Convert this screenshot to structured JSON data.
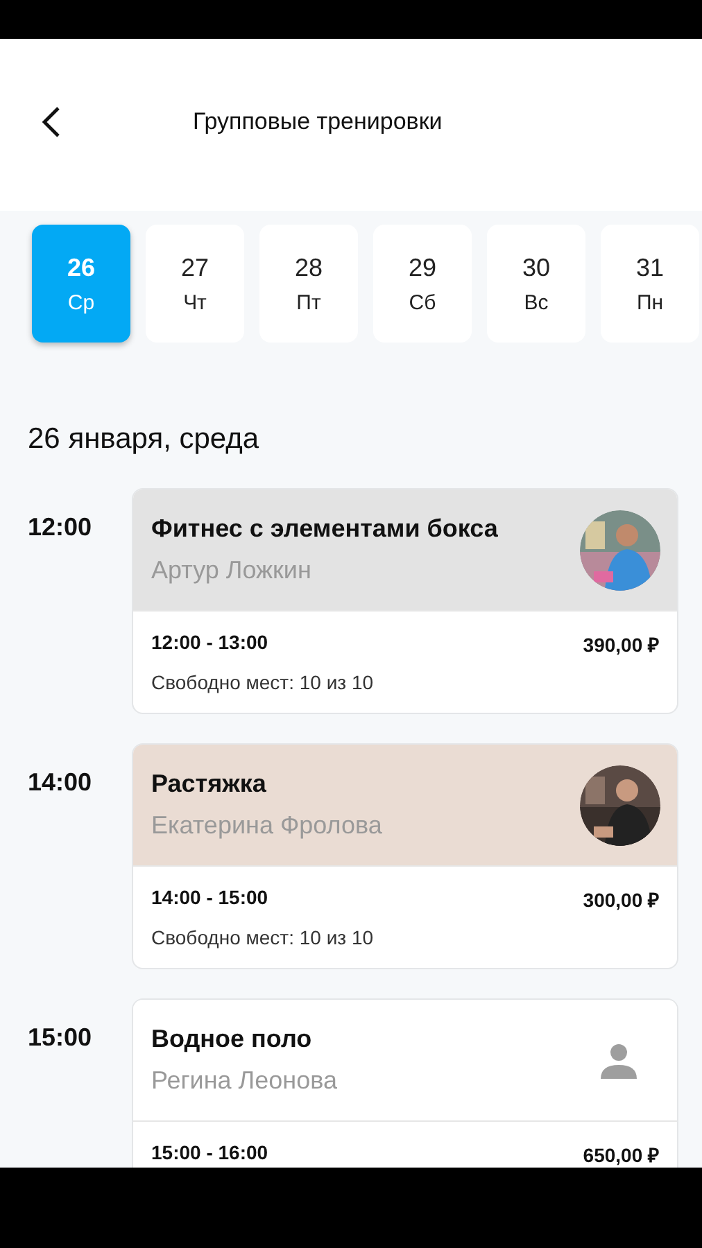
{
  "header": {
    "title": "Групповые тренировки"
  },
  "days": [
    {
      "day": "26",
      "weekday": "Ср",
      "selected": true
    },
    {
      "day": "27",
      "weekday": "Чт",
      "selected": false
    },
    {
      "day": "28",
      "weekday": "Пт",
      "selected": false
    },
    {
      "day": "29",
      "weekday": "Сб",
      "selected": false
    },
    {
      "day": "30",
      "weekday": "Вс",
      "selected": false
    },
    {
      "day": "31",
      "weekday": "Пн",
      "selected": false
    }
  ],
  "date_heading": "26 января, среда",
  "classes": [
    {
      "start": "12:00",
      "title": "Фитнес с элементами бокса",
      "trainer": "Артур Ложкин",
      "color": "#e3e3e3",
      "time_range": "12:00 - 13:00",
      "price": "390,00 ₽",
      "seats": "Свободно мест: 10 из 10"
    },
    {
      "start": "14:00",
      "title": "Растяжка",
      "trainer": "Екатерина Фролова",
      "color": "#eadcd3",
      "time_range": "14:00 - 15:00",
      "price": "300,00 ₽",
      "seats": "Свободно мест: 10 из 10"
    },
    {
      "start": "15:00",
      "title": "Водное поло",
      "trainer": "Регина Леонова",
      "kind": "placeholder",
      "color": "#ffffff",
      "time_range": "15:00 - 16:00",
      "price": "650,00 ₽"
    }
  ]
}
